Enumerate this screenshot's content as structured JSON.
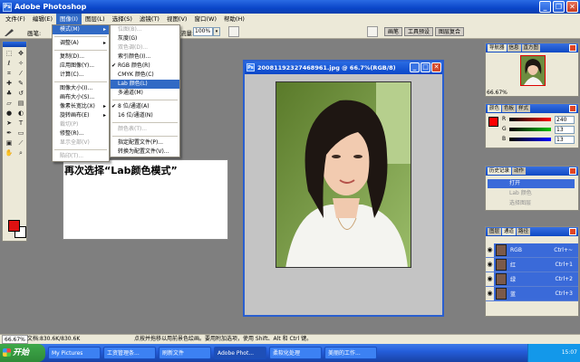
{
  "app": {
    "title": "Adobe Photoshop"
  },
  "menubar": [
    "文件(F)",
    "编辑(E)",
    "图像(I)",
    "图层(L)",
    "选择(S)",
    "滤镜(T)",
    "视图(V)",
    "窗口(W)",
    "帮助(H)"
  ],
  "options": {
    "brush_label": "画笔:",
    "flow_label": "流量:",
    "flow_value": "100%",
    "zoom_arrow": "▾"
  },
  "palette_tabs": [
    "画笔",
    "工具预设",
    "图层复合"
  ],
  "image_menu": {
    "items": [
      {
        "label": "模式(M)",
        "arrow": "▸",
        "selected": true
      },
      {
        "sep": true
      },
      {
        "label": "调整(A)",
        "arrow": "▸"
      },
      {
        "sep": true
      },
      {
        "label": "复制(D)..."
      },
      {
        "label": "应用图像(Y)..."
      },
      {
        "label": "计算(C)..."
      },
      {
        "sep": true
      },
      {
        "label": "图像大小(I)..."
      },
      {
        "label": "画布大小(S)..."
      },
      {
        "label": "像素长宽比(X)",
        "arrow": "▸"
      },
      {
        "label": "旋转画布(E)",
        "arrow": "▸"
      },
      {
        "label": "裁切(P)",
        "disabled": true
      },
      {
        "label": "修整(R)..."
      },
      {
        "label": "显示全部(V)",
        "disabled": true
      },
      {
        "sep": true
      },
      {
        "label": "陷印(T)...",
        "disabled": true
      }
    ]
  },
  "mode_menu": {
    "items": [
      {
        "label": "位图(B)...",
        "disabled": true
      },
      {
        "label": "灰度(G)"
      },
      {
        "label": "双色调(D)...",
        "disabled": true
      },
      {
        "label": "索引颜色(I)..."
      },
      {
        "label": "RGB 颜色(R)",
        "check": "✔"
      },
      {
        "label": "CMYK 颜色(C)"
      },
      {
        "label": "Lab 颜色(L)",
        "selected": true
      },
      {
        "label": "多通道(M)"
      },
      {
        "sep": true
      },
      {
        "label": "8 位/通道(A)",
        "check": "✔"
      },
      {
        "label": "16 位/通道(N)"
      },
      {
        "sep": true
      },
      {
        "label": "颜色表(T)...",
        "disabled": true
      },
      {
        "sep": true
      },
      {
        "label": "指定配置文件(P)..."
      },
      {
        "label": "转换为配置文件(V)..."
      }
    ]
  },
  "document": {
    "title": "20081192327468961.jpg @ 66.7%(RGB/8)",
    "icon": "Ps"
  },
  "note": {
    "text": "再次选择“Lab颜色模式”"
  },
  "navigator": {
    "tabs": [
      "导航器",
      "信息",
      "直方图"
    ],
    "zoom": "66.67%"
  },
  "color_panel": {
    "tabs": [
      "颜色",
      "色板",
      "样式"
    ],
    "channels": [
      {
        "label": "R",
        "value": "240",
        "color": "#ff0000"
      },
      {
        "label": "G",
        "value": "13",
        "color": "#00c000"
      },
      {
        "label": "B",
        "value": "13",
        "color": "#0000ff"
      }
    ]
  },
  "history_panel": {
    "tabs": [
      "历史记录",
      "动作"
    ],
    "items": [
      "打开",
      "Lab 颜色",
      "选择图层"
    ]
  },
  "layers_panel": {
    "tabs": [
      "图层",
      "通道",
      "路径"
    ],
    "channels": [
      {
        "label": "RGB",
        "shortcut": "Ctrl+~"
      },
      {
        "label": "红",
        "shortcut": "Ctrl+1"
      },
      {
        "label": "绿",
        "shortcut": "Ctrl+2"
      },
      {
        "label": "蓝",
        "shortcut": "Ctrl+3"
      }
    ]
  },
  "status": {
    "zoom": "66.67%",
    "doc": "文档:830.6K/830.6K",
    "hint": "点按并拖移以用前景色绘画。要用附加选项，使用 Shift、Alt 和 Ctrl 键。"
  },
  "taskbar": {
    "start": "开始",
    "items": [
      "My Pictures",
      "工资管理条...",
      "刷新文件",
      "Adobe Phot...",
      "柔软化处理",
      "美丽的工作..."
    ],
    "active_index": 3,
    "clock": "15:07"
  }
}
